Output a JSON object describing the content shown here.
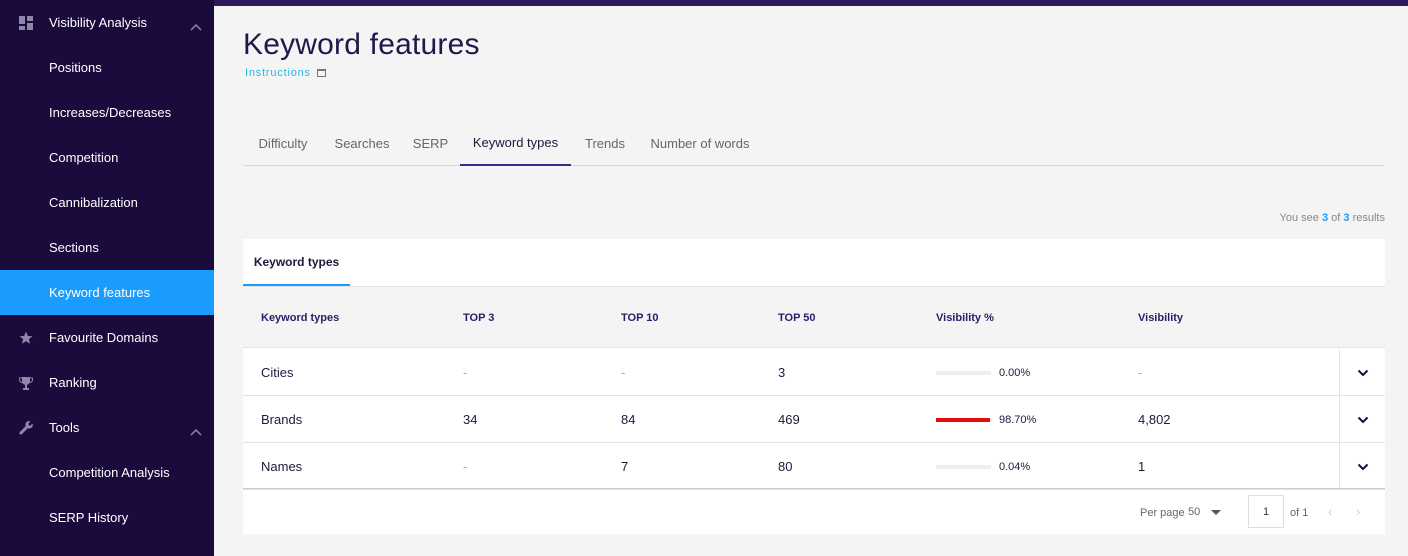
{
  "sidebar": {
    "items": [
      {
        "label": "Visibility Analysis",
        "icon": "dashboard-icon",
        "chevron": "up"
      },
      {
        "label": "Positions"
      },
      {
        "label": "Increases/Decreases"
      },
      {
        "label": "Competition"
      },
      {
        "label": "Cannibalization"
      },
      {
        "label": "Sections"
      },
      {
        "label": "Keyword features",
        "active": true
      },
      {
        "label": "Favourite Domains",
        "icon": "star-icon"
      },
      {
        "label": "Ranking",
        "icon": "trophy-icon"
      },
      {
        "label": "Tools",
        "icon": "wrench-icon",
        "chevron": "up"
      },
      {
        "label": "Competition Analysis"
      },
      {
        "label": "SERP History"
      }
    ],
    "colors": {
      "background": "#1b0a3c",
      "active": "#1a9cff"
    }
  },
  "header": {
    "title": "Keyword features",
    "instructions_label": "Instructions"
  },
  "tabs": [
    {
      "label": "Difficulty"
    },
    {
      "label": "Searches"
    },
    {
      "label": "SERP"
    },
    {
      "label": "Keyword types",
      "active": true
    },
    {
      "label": "Trends"
    },
    {
      "label": "Number of words"
    }
  ],
  "results": {
    "prefix": "You see",
    "shown": "3",
    "of": "of",
    "total": "3",
    "suffix": "results"
  },
  "card": {
    "tab_label": "Keyword types",
    "columns": [
      "Keyword types",
      "TOP 3",
      "TOP 10",
      "TOP 50",
      "Visibility %",
      "Visibility"
    ],
    "rows": [
      {
        "type": "Cities",
        "top3": "-",
        "top10": "-",
        "top50": "3",
        "visibility_pct": "0.00%",
        "visibility_fraction": 0.0,
        "visibility": "-"
      },
      {
        "type": "Brands",
        "top3": "34",
        "top10": "84",
        "top50": "469",
        "visibility_pct": "98.70%",
        "visibility_fraction": 0.987,
        "visibility": "4,802"
      },
      {
        "type": "Names",
        "top3": "-",
        "top10": "7",
        "top50": "80",
        "visibility_pct": "0.04%",
        "visibility_fraction": 0.0004,
        "visibility": "1"
      }
    ],
    "bar_color": "#e80c0c"
  },
  "pagination": {
    "per_page_label": "Per page",
    "per_page_value": "50",
    "current_page": "1",
    "of_pages": "of 1"
  }
}
